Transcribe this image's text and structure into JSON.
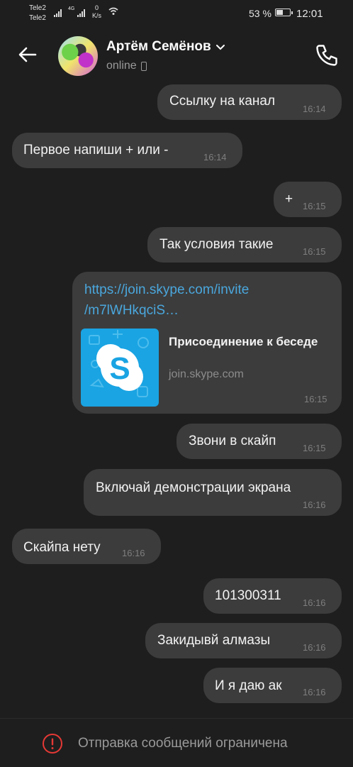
{
  "status_bar": {
    "carrier1": "Tele2",
    "carrier2": "Tele2",
    "network": "4G",
    "speed_value": "0",
    "speed_unit": "K/s",
    "battery_percent": "53 %",
    "battery_level": 0.53,
    "time": "12:01"
  },
  "header": {
    "contact_name": "Артём Семёнов",
    "status": "online",
    "icons": [
      "back-arrow-icon",
      "chevron-down-icon",
      "mobile-device-icon",
      "phone-icon"
    ]
  },
  "messages": [
    {
      "text": "Ссылку на канал",
      "time": "16:14",
      "side": "outgoing"
    },
    {
      "text": "Первое  напиши + или -",
      "time": "16:14",
      "side": "incoming"
    },
    {
      "text": "+",
      "time": "16:15",
      "side": "outgoing"
    },
    {
      "text": "Так условия такие",
      "time": "16:15",
      "side": "outgoing"
    },
    {
      "text": "Звони в скайп",
      "time": "16:15",
      "side": "outgoing"
    },
    {
      "text": "Включай демонстрации экрана",
      "time": "16:16",
      "side": "outgoing"
    },
    {
      "text": "Скайпа нету",
      "time": "16:16",
      "side": "incoming"
    },
    {
      "text": "101300311",
      "time": "16:16",
      "side": "outgoing"
    },
    {
      "text": "Закидывй алмазы",
      "time": "16:16",
      "side": "outgoing"
    },
    {
      "text": "И я даю ак",
      "time": "16:16",
      "side": "outgoing"
    }
  ],
  "link_message": {
    "url_line1": "https://join.skype.com/invite",
    "url_line2": "/m7lWHkqciS…",
    "preview_title": "Присоединение к беседе",
    "preview_domain": "join.skype.com",
    "time": "16:15",
    "side": "outgoing",
    "thumb_icon": "skype-logo-icon",
    "thumb_color": "#1aa4e3"
  },
  "footer": {
    "notice": "Отправка сообщений ограничена",
    "icon": "warning-circle-icon",
    "icon_color": "#e53935"
  },
  "colors": {
    "background": "#1e1e1e",
    "bubble": "#3c3c3c",
    "link": "#4aa7dd"
  }
}
